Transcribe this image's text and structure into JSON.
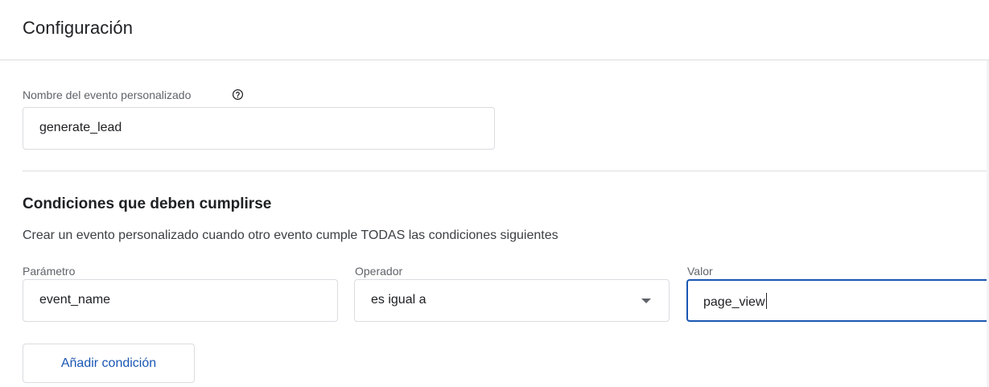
{
  "header": {
    "title": "Configuración"
  },
  "event_name": {
    "label": "Nombre del evento personalizado",
    "help_icon": "help-circle-icon",
    "value": "generate_lead"
  },
  "conditions": {
    "title": "Condiciones que deben cumplirse",
    "description": "Crear un evento personalizado cuando otro evento cumple TODAS las condiciones siguientes",
    "parameter": {
      "label": "Parámetro",
      "value": "event_name"
    },
    "operator": {
      "label": "Operador",
      "value": "es igual a",
      "icon": "dropdown-arrow-icon"
    },
    "valor": {
      "label": "Valor",
      "value": "page_view"
    },
    "add_button_label": "Añadir condición"
  },
  "colors": {
    "accent": "#1a56b3",
    "border": "#dadce0",
    "label": "#5f6368",
    "text": "#202124"
  }
}
